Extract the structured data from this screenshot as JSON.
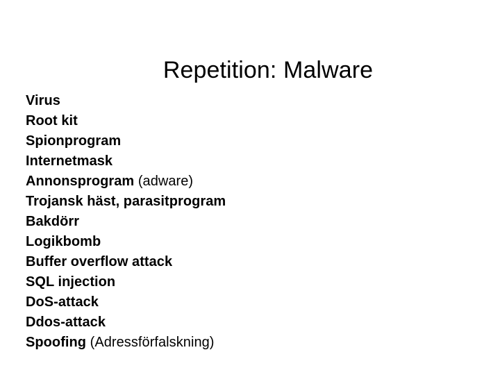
{
  "slide": {
    "title": "Repetition: Malware",
    "background_color": "#ffffff",
    "text_color": "#000000",
    "items": [
      {
        "term": "Virus",
        "note": ""
      },
      {
        "term": "Root kit",
        "note": ""
      },
      {
        "term": "Spionprogram",
        "note": ""
      },
      {
        "term": "Internetmask",
        "note": ""
      },
      {
        "term": "Annonsprogram",
        "note": " (adware)"
      },
      {
        "term": "Trojansk häst, parasitprogram",
        "note": ""
      },
      {
        "term": "Bakdörr",
        "note": ""
      },
      {
        "term": "Logikbomb",
        "note": ""
      },
      {
        "term": "Buffer overflow attack",
        "note": ""
      },
      {
        "term": "SQL injection",
        "note": ""
      },
      {
        "term": "DoS-attack",
        "note": ""
      },
      {
        "term": "Ddos-attack",
        "note": ""
      },
      {
        "term": "Spoofing",
        "note": " (Adressförfalskning)"
      }
    ]
  }
}
